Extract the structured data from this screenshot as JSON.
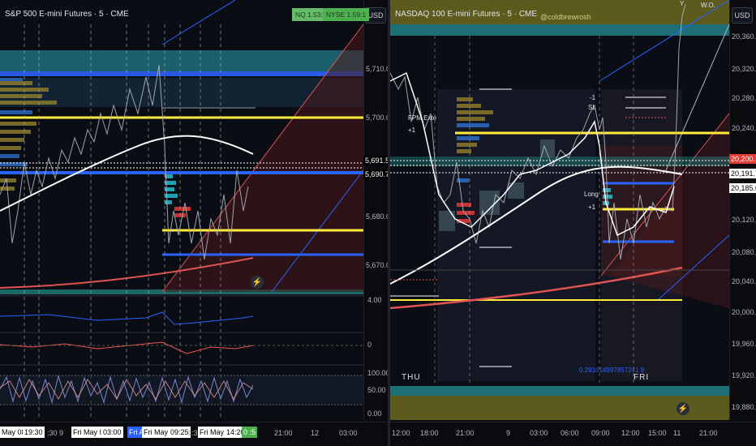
{
  "left": {
    "title": "S&P 500 E-mini Futures · 5 · CME",
    "currency_button": "USD",
    "ratios": {
      "nq": "NQ 1.53:1",
      "nyse": "NYSE 1.59:1"
    },
    "price_ticks": [
      "5,710.00",
      "5,700.00",
      "5,680.00",
      "5,670.00"
    ],
    "price_labels": {
      "upper": "5,691.50",
      "lower": "5,690.75"
    },
    "indicator_ticks": [
      "4.00",
      "0",
      "100.00",
      "50.00",
      "0.00"
    ],
    "time_labels": {
      "plain": [
        "9",
        "21:00",
        "12",
        "03:00",
        ":30",
        "1:30"
      ],
      "white_boxes": [
        "May 08",
        "19:30",
        "Fri May 09",
        "03:00",
        "Fri May 09",
        "09:25",
        "Fri May 09",
        "14:20"
      ],
      "blue_box": "Fri A",
      "green_box": "0 :5"
    },
    "colors": {
      "highlight": "#2962ff",
      "green": "#4caf50"
    }
  },
  "right": {
    "title": "NASDAQ 100 E-mini Futures · 5 · CME",
    "watermark": "@coldbrewrosh",
    "currency_button": "USD",
    "price_ticks": [
      "20,360.00",
      "20,320.00",
      "20,280.00",
      "20,240.00",
      "20,120.00",
      "20,080.00",
      "20,040.00",
      "20,000.00",
      "19,960.00",
      "19,920.00",
      "19,880.00"
    ],
    "price_labels": {
      "top": "20,200.75",
      "mid": "20,191.75",
      "low": "20,185.00"
    },
    "time_ticks": [
      "12:00",
      "18:00",
      "21:00",
      "9",
      "03:00",
      "06:00",
      "09:00",
      "12:00",
      "15:00",
      "11",
      "21:00"
    ],
    "day_labels": [
      "THU",
      "FRI"
    ],
    "annotations": {
      "fib": "0.291014997857241 9",
      "sl": "SL",
      "minus1": "-1",
      "long": "Long",
      "plus1": "+1",
      "fpm": "FPM Exte",
      "plus1b": "+1",
      "wo": "W.O.",
      "top_y": "Y"
    }
  }
}
